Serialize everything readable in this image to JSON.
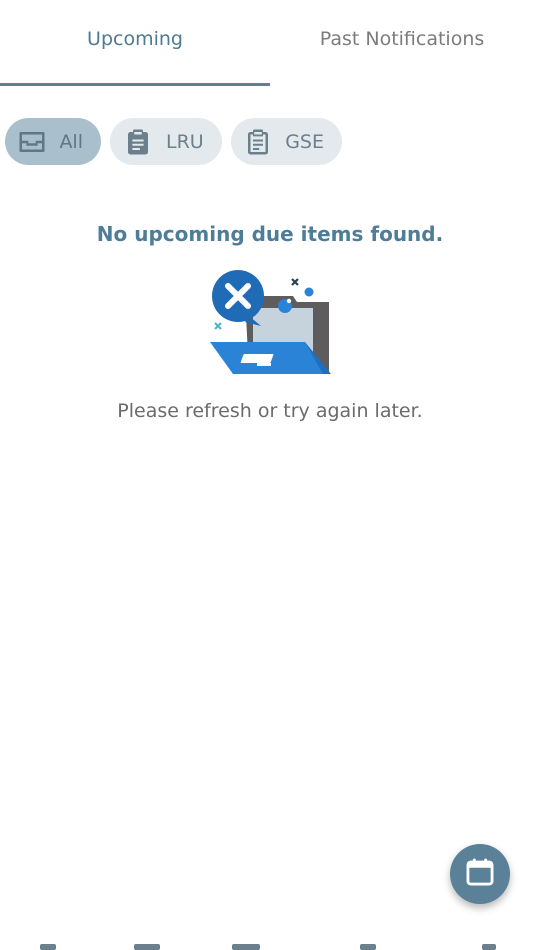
{
  "tabs": {
    "upcoming": "Upcoming",
    "past": "Past Notifications"
  },
  "filters": [
    {
      "label": "All",
      "icon": "inbox-tray-icon",
      "selected": true
    },
    {
      "label": "LRU",
      "icon": "clipboard-icon",
      "selected": false
    },
    {
      "label": "GSE",
      "icon": "clipboard-outline-icon",
      "selected": false
    }
  ],
  "empty_state": {
    "title": "No upcoming due items found.",
    "subtitle": "Please refresh or try again later.",
    "illustration": "empty-folder-error-illustration"
  },
  "fab": {
    "icon": "calendar-icon"
  },
  "colors": {
    "accent": "#5a8198",
    "title": "#4d7d98",
    "chip_bg": "#e4e9ed",
    "chip_selected_bg": "#a9bfcc"
  }
}
